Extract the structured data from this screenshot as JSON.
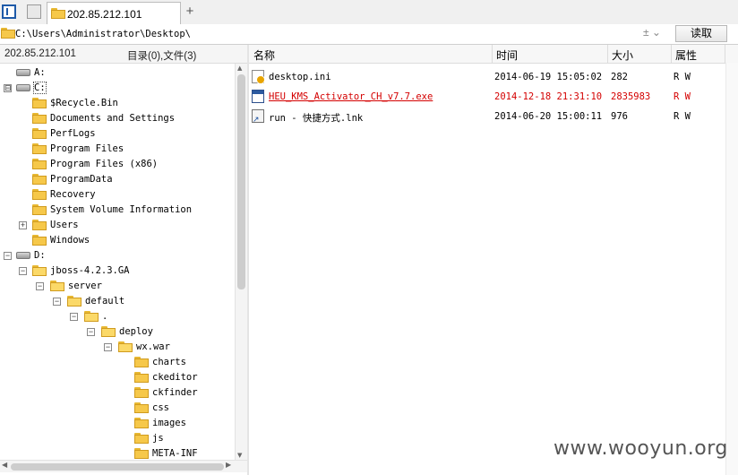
{
  "tabs": [
    {
      "label": "202.85.212.101",
      "active": true
    }
  ],
  "tab_add_label": "+",
  "address": {
    "path": "C:\\Users\\Administrator\\Desktop\\",
    "tools": "±  ⌄",
    "read_button": "读取"
  },
  "left_header": {
    "host": "202.85.212.101",
    "count": "目录(0),文件(3)"
  },
  "tree": [
    {
      "label": "A:",
      "type": "drive",
      "expander": ""
    },
    {
      "label": "C:",
      "type": "drive",
      "expander": "⊟",
      "boxed": true
    },
    {
      "label": "$Recycle.Bin",
      "type": "folder",
      "expander": ""
    },
    {
      "label": "Documents and Settings",
      "type": "folder",
      "expander": ""
    },
    {
      "label": "PerfLogs",
      "type": "folder",
      "expander": ""
    },
    {
      "label": "Program Files",
      "type": "folder",
      "expander": ""
    },
    {
      "label": "Program Files (x86)",
      "type": "folder",
      "expander": ""
    },
    {
      "label": "ProgramData",
      "type": "folder",
      "expander": ""
    },
    {
      "label": "Recovery",
      "type": "folder",
      "expander": ""
    },
    {
      "label": "System Volume Information",
      "type": "folder",
      "expander": ""
    },
    {
      "label": "Users",
      "type": "folder",
      "expander": "+"
    },
    {
      "label": "Windows",
      "type": "folder",
      "expander": ""
    },
    {
      "label": "D:",
      "type": "drive",
      "expander": "−"
    },
    {
      "label": "jboss-4.2.3.GA",
      "type": "folder",
      "expander": "−"
    },
    {
      "label": "server",
      "type": "folder",
      "expander": "−"
    },
    {
      "label": "default",
      "type": "folder",
      "expander": "−"
    },
    {
      "label": ".",
      "type": "folder",
      "expander": "−"
    },
    {
      "label": "deploy",
      "type": "folder",
      "expander": "−"
    },
    {
      "label": "wx.war",
      "type": "folder",
      "expander": "−"
    },
    {
      "label": "charts",
      "type": "folder",
      "expander": ""
    },
    {
      "label": "ckeditor",
      "type": "folder",
      "expander": ""
    },
    {
      "label": "ckfinder",
      "type": "folder",
      "expander": ""
    },
    {
      "label": "css",
      "type": "folder",
      "expander": ""
    },
    {
      "label": "images",
      "type": "folder",
      "expander": ""
    },
    {
      "label": "js",
      "type": "folder",
      "expander": ""
    },
    {
      "label": "META-INF",
      "type": "folder",
      "expander": ""
    }
  ],
  "file_list": {
    "headers": {
      "name": "名称",
      "time": "时间",
      "size": "大小",
      "attr": "属性"
    },
    "rows": [
      {
        "name": "desktop.ini",
        "time": "2014-06-19 15:05:02",
        "size": "282",
        "attr": "R W",
        "icon": "ini-file-icon",
        "highlight": false
      },
      {
        "name": "HEU_KMS_Activator_CH_v7.7.exe",
        "time": "2014-12-18 21:31:10",
        "size": "2835983",
        "attr": "R W",
        "icon": "exe-file-icon",
        "highlight": true
      },
      {
        "name": "run - 快捷方式.lnk",
        "time": "2014-06-20 15:00:11",
        "size": "976",
        "attr": "R W",
        "icon": "shortcut-file-icon",
        "highlight": false
      }
    ]
  },
  "colors": {
    "highlight_text": "#d40000",
    "folder": "#f6c84a"
  },
  "watermark": "www.wooyun.org"
}
